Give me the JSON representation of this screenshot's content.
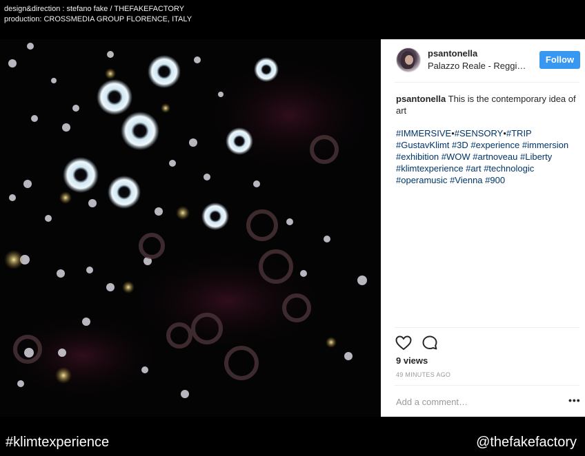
{
  "credits": {
    "line1": "design&direction : stefano fake / THEFAKEFACTORY",
    "line2": "production: CROSSMEDIA GROUP FLORENCE, ITALY"
  },
  "post": {
    "username": "psantonella",
    "location": "Palazzo Reale - Reggi…",
    "follow_label": "Follow",
    "caption_user": "psantonella",
    "caption_text": " This is the contemporary idea of art",
    "hashtags": [
      "#IMMERSIVE",
      "•",
      "#SENSORY",
      "•",
      "#TRIP",
      " ",
      "#GustavKlimt",
      " ",
      "#3D",
      " ",
      "#experience",
      " ",
      "#immersion",
      " ",
      "#exhibition",
      " ",
      "#WOW",
      " ",
      "#artnoveau",
      " ",
      "#Liberty",
      " ",
      "#klimtexperience",
      " ",
      "#art",
      " ",
      "#technologic",
      " ",
      "#operamusic",
      " ",
      "#Vienna",
      " ",
      "#900"
    ],
    "views": "9 views",
    "time_ago": "49 MINUTES AGO",
    "comment_placeholder": "Add a comment…",
    "more_label": "•••"
  },
  "icons": {
    "like": "heart-icon",
    "comment": "comment-bubble-icon"
  },
  "colors": {
    "follow_bg": "#3897f0",
    "hashtag": "#003569",
    "background": "#000000"
  },
  "footer": {
    "left": "#klimtexperience",
    "right": "@thefakefactory"
  }
}
